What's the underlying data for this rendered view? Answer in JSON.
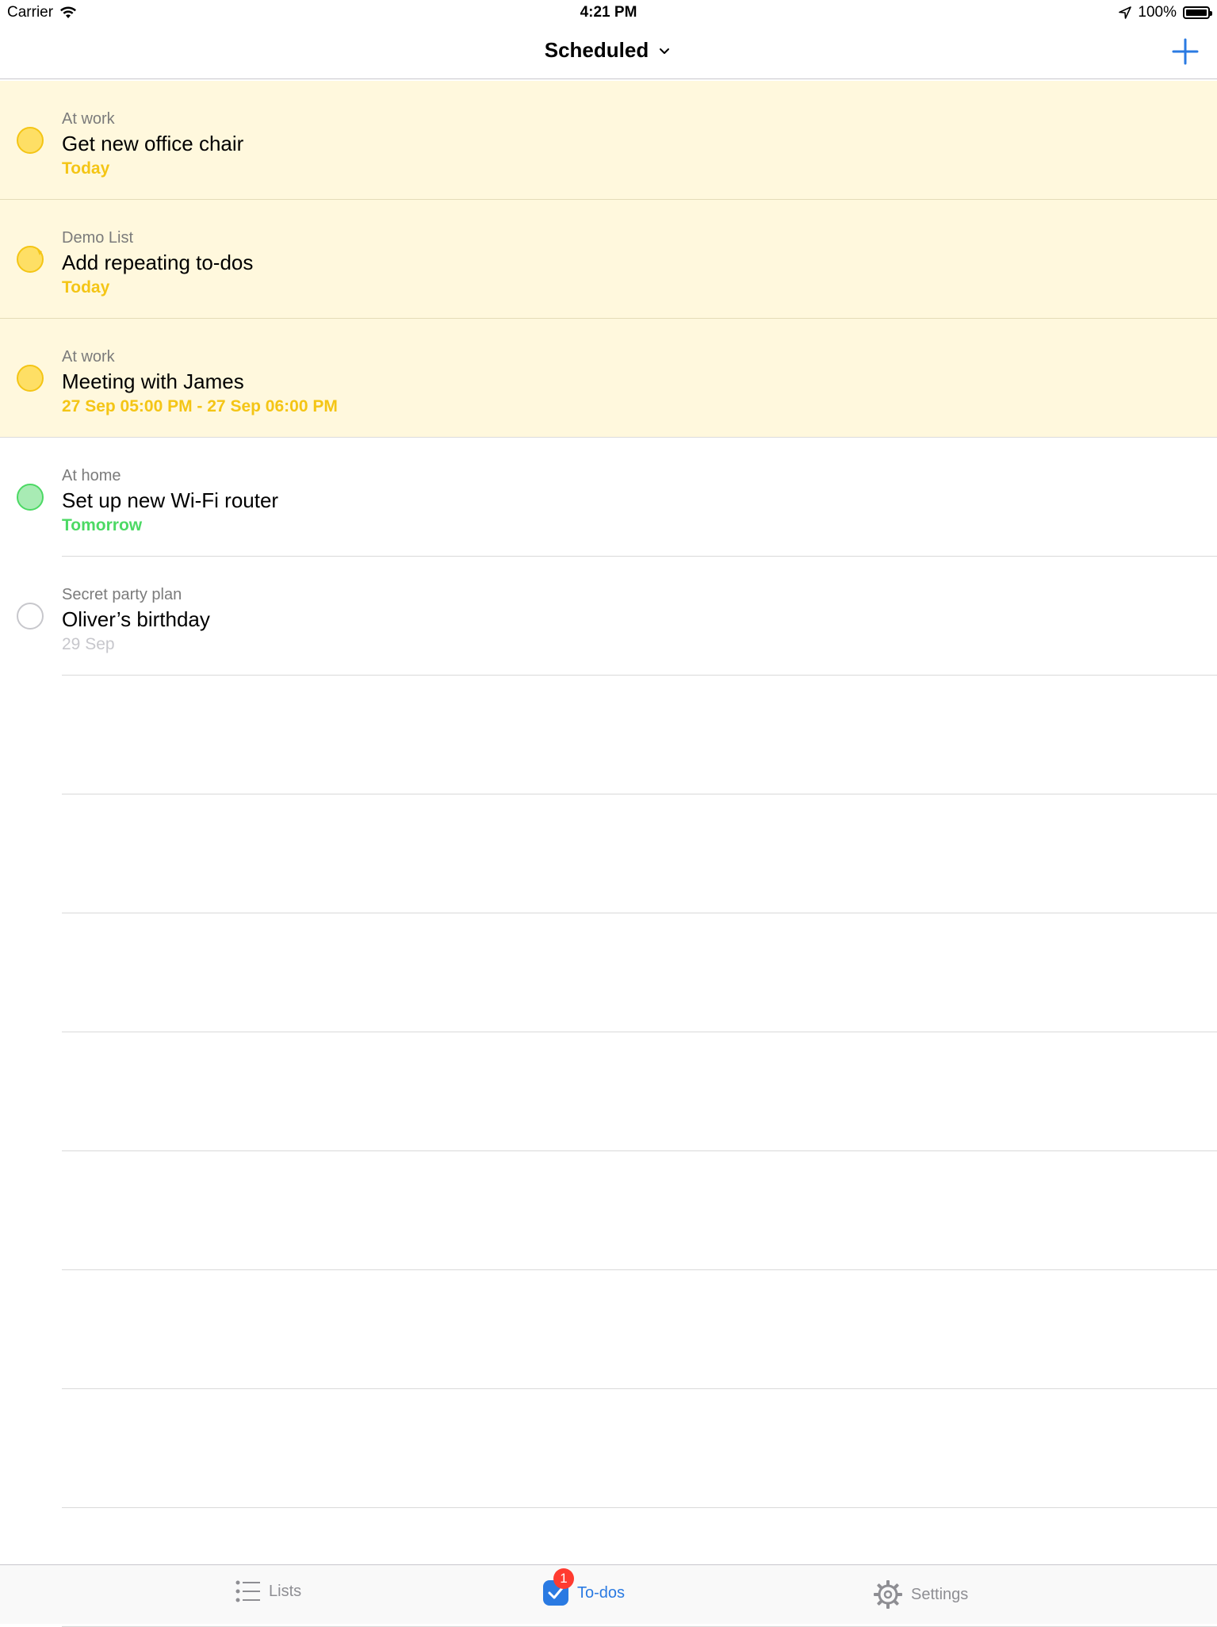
{
  "status_bar": {
    "carrier": "Carrier",
    "time": "4:21 PM",
    "battery": "100%"
  },
  "nav": {
    "title": "Scheduled"
  },
  "todos": [
    {
      "list": "At work",
      "title": "Get new office chair",
      "date": "Today",
      "style": "yellow",
      "repeating": false,
      "completed": false
    },
    {
      "list": "Demo List",
      "title": "Add repeating to-dos",
      "date": "Today",
      "style": "yellow",
      "repeating": true,
      "completed": false
    },
    {
      "list": "At work",
      "title": "Meeting with James",
      "date": "27 Sep 05:00 PM - 27 Sep 06:00 PM",
      "style": "yellow",
      "repeating": false,
      "completed": false
    },
    {
      "list": "At home",
      "title": "Set up new Wi-Fi router",
      "date": "Tomorrow",
      "style": "green",
      "repeating": false,
      "completed": false
    },
    {
      "list": "Secret party plan",
      "title": "Oliver’s birthday",
      "date": "29 Sep",
      "style": "grey",
      "repeating": false,
      "completed": false
    }
  ],
  "tab_bar": {
    "lists_label": "Lists",
    "todos_label": "To-dos",
    "settings_label": "Settings",
    "todos_badge": "1",
    "active_tab": "To-dos"
  },
  "colors": {
    "accent": "#2a7ae2",
    "today_yellow": "#f4c515",
    "tomorrow_green": "#4cd964",
    "highlight_bg": "#fff8dd",
    "badge_red": "#ff3b30"
  }
}
